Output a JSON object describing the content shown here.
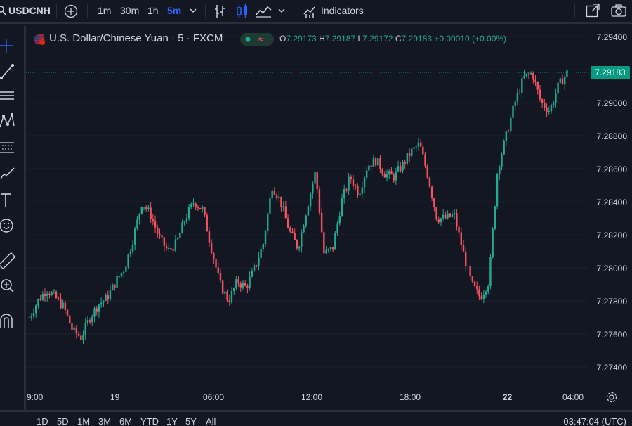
{
  "toolbar": {
    "symbol": "USDCNH",
    "timeframes": [
      "1m",
      "30m",
      "1h",
      "5m"
    ],
    "active_timeframe": "5m",
    "indicators_label": "Indicators"
  },
  "legend": {
    "title": "U.S. Dollar/Chinese Yuan · 5 · FXCM",
    "badge": "≈",
    "open_key": "O",
    "open": "7.29173",
    "high_key": "H",
    "high": "7.29187",
    "low_key": "L",
    "low": "7.29172",
    "close_key": "C",
    "close": "7.29183",
    "change": "+0.00010 (+0.00%)"
  },
  "price_axis": {
    "labels": [
      "7.29400",
      "7.29000",
      "7.28800",
      "7.28600",
      "7.28400",
      "7.28200",
      "7.28000",
      "7.27800",
      "7.27600",
      "7.27400"
    ],
    "current_price": "7.29183"
  },
  "time_axis": {
    "labels": [
      "9:00",
      "19",
      "06:00",
      "12:00",
      "18:00",
      "22",
      "04:00"
    ]
  },
  "bottom": {
    "ranges": [
      "1D",
      "5D",
      "1M",
      "3M",
      "6M",
      "YTD",
      "1Y",
      "5Y",
      "All"
    ],
    "clock": "03:47:04 (UTC)"
  },
  "colors": {
    "up": "#22ab94",
    "down": "#f7525f",
    "background": "#131722",
    "accent": "#2962ff"
  },
  "chart_data": {
    "type": "candlestick",
    "title": "U.S. Dollar/Chinese Yuan · 5 · FXCM",
    "ylim": [
      7.273,
      7.295
    ],
    "close_path": [
      7.277,
      7.278,
      7.2787,
      7.2782,
      7.2776,
      7.2762,
      7.2758,
      7.277,
      7.2778,
      7.2782,
      7.2792,
      7.28,
      7.2818,
      7.284,
      7.2832,
      7.2818,
      7.281,
      7.2815,
      7.283,
      7.284,
      7.2835,
      7.2812,
      7.279,
      7.278,
      7.2792,
      7.2788,
      7.28,
      7.2815,
      7.285,
      7.284,
      7.2822,
      7.2812,
      7.2836,
      7.2858,
      7.2808,
      7.2812,
      7.284,
      7.2855,
      7.2845,
      7.2862,
      7.2865,
      7.2857,
      7.2855,
      7.2862,
      7.287,
      7.2875,
      7.2855,
      7.283,
      7.283,
      7.2832,
      7.281,
      7.279,
      7.2782,
      7.2792,
      7.286,
      7.288,
      7.29,
      7.2915,
      7.2918,
      7.29,
      7.2895,
      7.291,
      7.2918
    ]
  }
}
